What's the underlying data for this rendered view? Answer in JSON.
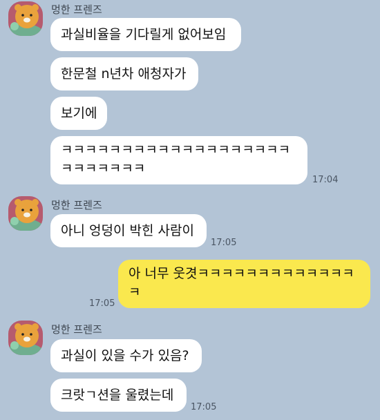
{
  "colors": {
    "background": "#b3c4d6",
    "bubble_received": "#ffffff",
    "bubble_sent": "#fae84e",
    "avatar_bg": "#b65b6e"
  },
  "icons": {
    "avatar": "ryan-character-avatar"
  },
  "groups": [
    {
      "sender": "멍한 프렌즈",
      "messages": [
        {
          "text": "과실비율을 기다릴게 없어보임"
        },
        {
          "text": "한문철 n년차 애청자가"
        },
        {
          "text": "보기에"
        },
        {
          "text": "ㅋㅋㅋㅋㅋㅋㅋㅋㅋㅋㅋㅋㅋㅋㅋㅋㅋㅋㅋㅋㅋㅋㅋㅋㅋㅋ"
        }
      ],
      "time": "17:04"
    },
    {
      "sender": "멍한 프렌즈",
      "messages": [
        {
          "text": "아니 엉덩이 박힌 사람이"
        }
      ],
      "time": "17:05"
    },
    {
      "sender": "me",
      "messages": [
        {
          "text": "아 너무 웃겻ㅋㅋㅋㅋㅋㅋㅋㅋㅋㅋㅋㅋㅋㅋ"
        }
      ],
      "time": "17:05"
    },
    {
      "sender": "멍한 프렌즈",
      "messages": [
        {
          "text": "과실이 있을 수가 있음?"
        },
        {
          "text": "크랏ㄱ션을 울렸는데"
        }
      ],
      "time": "17:05"
    }
  ]
}
